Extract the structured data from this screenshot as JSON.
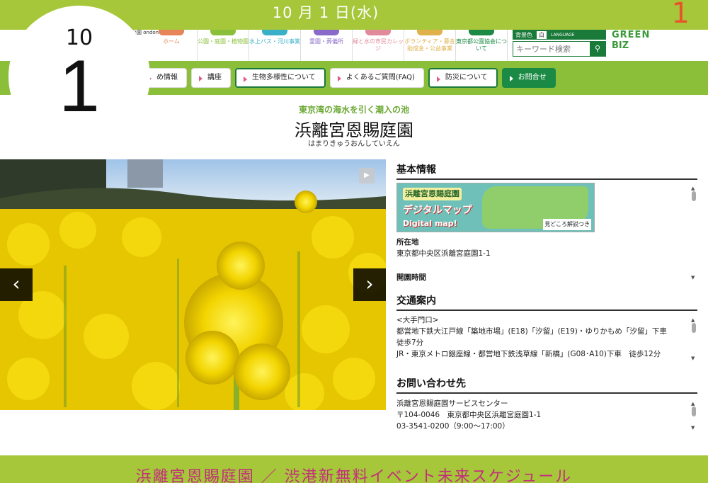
{
  "banner": {
    "date": "10 月 1 日(水)",
    "corner_number": "1"
  },
  "calendar": {
    "month": "10",
    "day": "1"
  },
  "header": {
    "logo_text": "公園\nondon",
    "nav_icons": [
      {
        "label": "ホーム",
        "color": "#e8845a"
      },
      {
        "label": "公園・庭園・植物園",
        "color": "#8bbf3a"
      },
      {
        "label": "水上バス・河川事業",
        "color": "#3ab0c8"
      },
      {
        "label": "霊園・葬儀所",
        "color": "#8a6ac8"
      },
      {
        "label": "緑と水の市民カレッジ",
        "color": "#e08a9a"
      },
      {
        "label": "ボランティア・募金助成金・公益事業",
        "color": "#e0b04a"
      },
      {
        "label": "東京都公園協会について",
        "color": "#1a8a44"
      }
    ],
    "lang_label": "背景色",
    "lang_select": "白",
    "lang_icon_text": "LANGUAGE",
    "search_placeholder": "キーワード検索",
    "green_biz_1": "GREEN",
    "green_biz_2": "BIZ"
  },
  "nav": {
    "items": [
      {
        "label": "め情報",
        "style": "plain"
      },
      {
        "label": "講座",
        "style": "plain"
      },
      {
        "label": "生物多様性について",
        "style": "outline"
      },
      {
        "label": "よくあるご質問(FAQ)",
        "style": "plain"
      },
      {
        "label": "防災について",
        "style": "outline"
      },
      {
        "label": "お問合せ",
        "style": "dark"
      }
    ]
  },
  "page": {
    "subtitle": "東京湾の海水を引く潮入の池",
    "title": "浜離宮恩賜庭園",
    "ruby": "はまりきゅうおんしていえん"
  },
  "photo": {
    "prev": "‹",
    "next": "›",
    "play": "▶"
  },
  "info": {
    "basic": {
      "title": "基本情報",
      "map_title": "浜離宮恩賜庭園",
      "map_digital": "デジタルマップ",
      "map_en": "Digital map!",
      "map_note": "見どころ解説つき",
      "location_label": "所在地",
      "location": "東京都中央区浜離宮庭園1-1",
      "hours_label": "開園時間"
    },
    "access": {
      "title": "交通案内",
      "gate": "<大手門口>",
      "line1": "都営地下鉄大江戸線「築地市場」(E18)「汐留」(E19)・ゆりかもめ「汐留」下車",
      "line2": "徒歩7分",
      "line3": "JR・東京メトロ銀座線・都営地下鉄浅草線「新橋」(G08･A10)下車　徒歩12分"
    },
    "contact": {
      "title": "お問い合わせ先",
      "name": "浜離宮恩賜庭園サービスセンター",
      "address": "〒104-0046　東京都中央区浜離宮庭園1-1",
      "phone": "03-3541-0200（9:00～17:00）"
    }
  },
  "bottom": {
    "text": "浜離宮恩賜庭園 ／ 渋港新無料イベント未来スケジュール"
  }
}
